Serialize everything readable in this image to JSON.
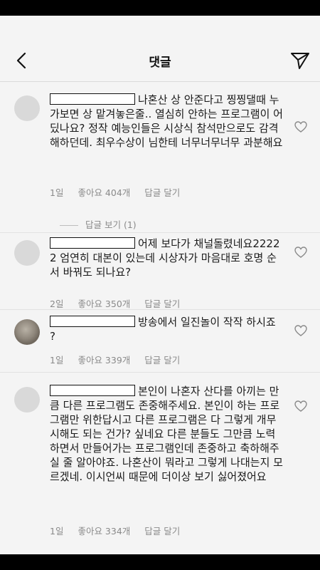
{
  "header": {
    "title": "댓글",
    "back_icon": "chevron-left-icon",
    "send_icon": "paper-plane-icon"
  },
  "comments": [
    {
      "text": "나혼산 상 안준다고 찡찡댈때 누가보면 상 맡겨놓은줄.. 열심히 안하는 프로그램이 어딨나요? 정작 예능인들은 시상식 참석만으로도 감격해하던데. 최우수상이 님한테 너무너무너무 과분해요",
      "time": "1일",
      "likes": "좋아요 404개",
      "reply": "답글 달기",
      "view_replies": "답글 보기 (1)"
    },
    {
      "text": "어제 보다가 채널돌렸네요22222 엄연히 대본이 있는데 시상자가 마음대로 호명 순서 바꿔도 되나요?",
      "time": "2일",
      "likes": "좋아요 350개",
      "reply": "답글 달기"
    },
    {
      "text": "방송에서 일진놀이 작작 하시죠 ?",
      "time": "1일",
      "likes": "좋아요 339개",
      "reply": "답글 달기"
    },
    {
      "text": "본인이 나혼자 산다를 아끼는 만큼 다른 프로그램도 존중해주세요. 본인이 하는 프로그램만 위한답시고 다른 프로그램은 다 그렇게 개무시해도 되는 건가? 싶네요 다른 분들도 그만큼 노력하면서 만들어가는 프로그램인데 존중하고 축하해주실 줄 알아야죠. 나혼산이 뭐라고 그렇게 나대는지 모르겠네. 이시언씨 때문에 더이상 보기 싫어졌어요",
      "time": "1일",
      "likes": "좋아요 334개",
      "reply": "답글 달기"
    }
  ],
  "icons": {
    "like": "heart-outline-icon"
  },
  "colors": {
    "background": "#f4f4f4",
    "meta_text": "#8a8a8a",
    "bars": "#000000"
  }
}
